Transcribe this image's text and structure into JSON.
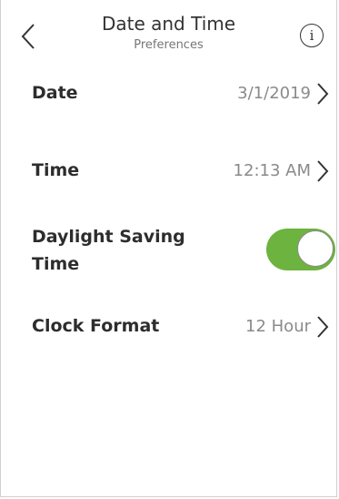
{
  "header": {
    "title": "Date and Time",
    "subtitle": "Preferences",
    "back_icon": "chevron-left-icon",
    "info_icon": "info-icon",
    "info_glyph": "i"
  },
  "settings": {
    "date": {
      "label": "Date",
      "value": "3/1/2019"
    },
    "time": {
      "label": "Time",
      "value": "12:13 AM"
    },
    "daylight_saving": {
      "label": "Daylight Saving Time",
      "enabled": true
    },
    "clock_format": {
      "label": "Clock Format",
      "value": "12 Hour"
    }
  },
  "colors": {
    "toggle_on": "#6db33f",
    "text_primary": "#2d2d2d",
    "text_secondary": "#8a8a8a"
  }
}
